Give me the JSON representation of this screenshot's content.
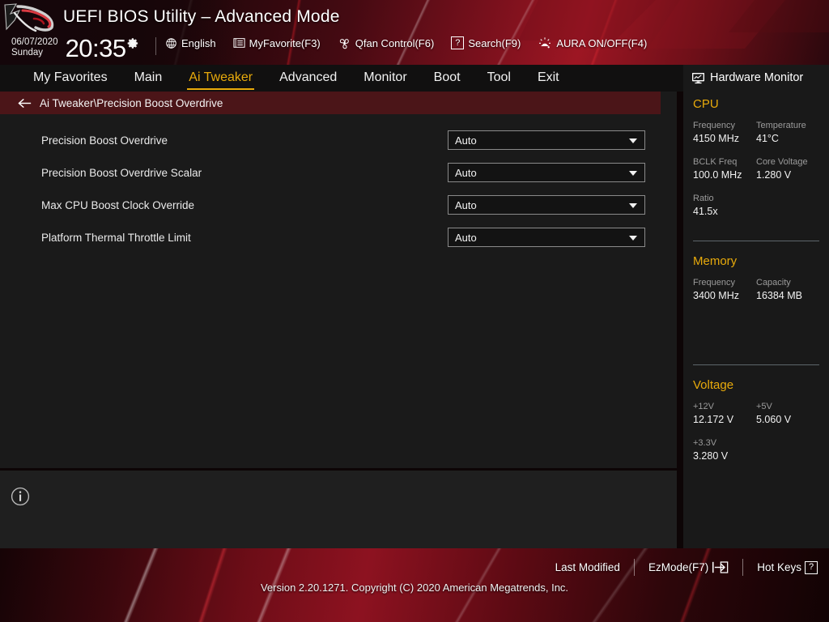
{
  "header": {
    "title": "UEFI BIOS Utility – Advanced Mode",
    "logo_icon": "rog-logo-icon",
    "date": "06/07/2020",
    "day": "Sunday",
    "time": "20:35",
    "gear_icon": "gear-icon",
    "items": [
      {
        "label": "English",
        "icon": "globe-icon"
      },
      {
        "label": "MyFavorite(F3)",
        "icon": "list-icon"
      },
      {
        "label": "Qfan Control(F6)",
        "icon": "fan-icon"
      },
      {
        "label": "Search(F9)",
        "icon": "question-box-icon"
      },
      {
        "label": "AURA ON/OFF(F4)",
        "icon": "aura-lamp-icon"
      }
    ]
  },
  "nav": {
    "tabs": [
      {
        "label": "My Favorites",
        "active": false
      },
      {
        "label": "Main",
        "active": false
      },
      {
        "label": "Ai Tweaker",
        "active": true
      },
      {
        "label": "Advanced",
        "active": false
      },
      {
        "label": "Monitor",
        "active": false
      },
      {
        "label": "Boot",
        "active": false
      },
      {
        "label": "Tool",
        "active": false
      },
      {
        "label": "Exit",
        "active": false
      }
    ],
    "active_color": "#e8aa0b"
  },
  "breadcrumb": {
    "back_icon": "arrow-left-icon",
    "path": "Ai Tweaker\\Precision Boost Overdrive",
    "background": "#4b1518"
  },
  "settings": {
    "rows": [
      {
        "label": "Precision Boost Overdrive",
        "value": "Auto"
      },
      {
        "label": "Precision Boost Overdrive Scalar",
        "value": "Auto"
      },
      {
        "label": "Max CPU Boost Clock Override",
        "value": "Auto"
      },
      {
        "label": "Platform Thermal Throttle Limit",
        "value": "Auto"
      }
    ]
  },
  "help": {
    "info_icon": "info-circle-icon",
    "text": ""
  },
  "hardware_monitor": {
    "title": "Hardware Monitor",
    "title_icon": "monitor-chart-icon",
    "heading_color": "#e8aa0b",
    "sections": [
      {
        "name": "CPU",
        "entries": [
          {
            "key": "Frequency",
            "value": "4150 MHz"
          },
          {
            "key": "Temperature",
            "value": "41°C"
          },
          {
            "key": "BCLK Freq",
            "value": "100.0 MHz"
          },
          {
            "key": "Core Voltage",
            "value": "1.280 V"
          },
          {
            "key": "Ratio",
            "value": "41.5x"
          }
        ]
      },
      {
        "name": "Memory",
        "entries": [
          {
            "key": "Frequency",
            "value": "3400 MHz"
          },
          {
            "key": "Capacity",
            "value": "16384 MB"
          }
        ]
      },
      {
        "name": "Voltage",
        "entries": [
          {
            "key": "+12V",
            "value": "12.172 V"
          },
          {
            "key": "+5V",
            "value": "5.060 V"
          },
          {
            "key": "+3.3V",
            "value": "3.280 V"
          }
        ]
      }
    ]
  },
  "footer": {
    "last_modified": "Last Modified",
    "ezmode": "EzMode(F7)",
    "ezmode_icon": "exit-arrow-icon",
    "hotkeys": "Hot Keys",
    "hotkeys_key": "?",
    "version": "Version 2.20.1271. Copyright (C) 2020 American Megatrends, Inc."
  }
}
